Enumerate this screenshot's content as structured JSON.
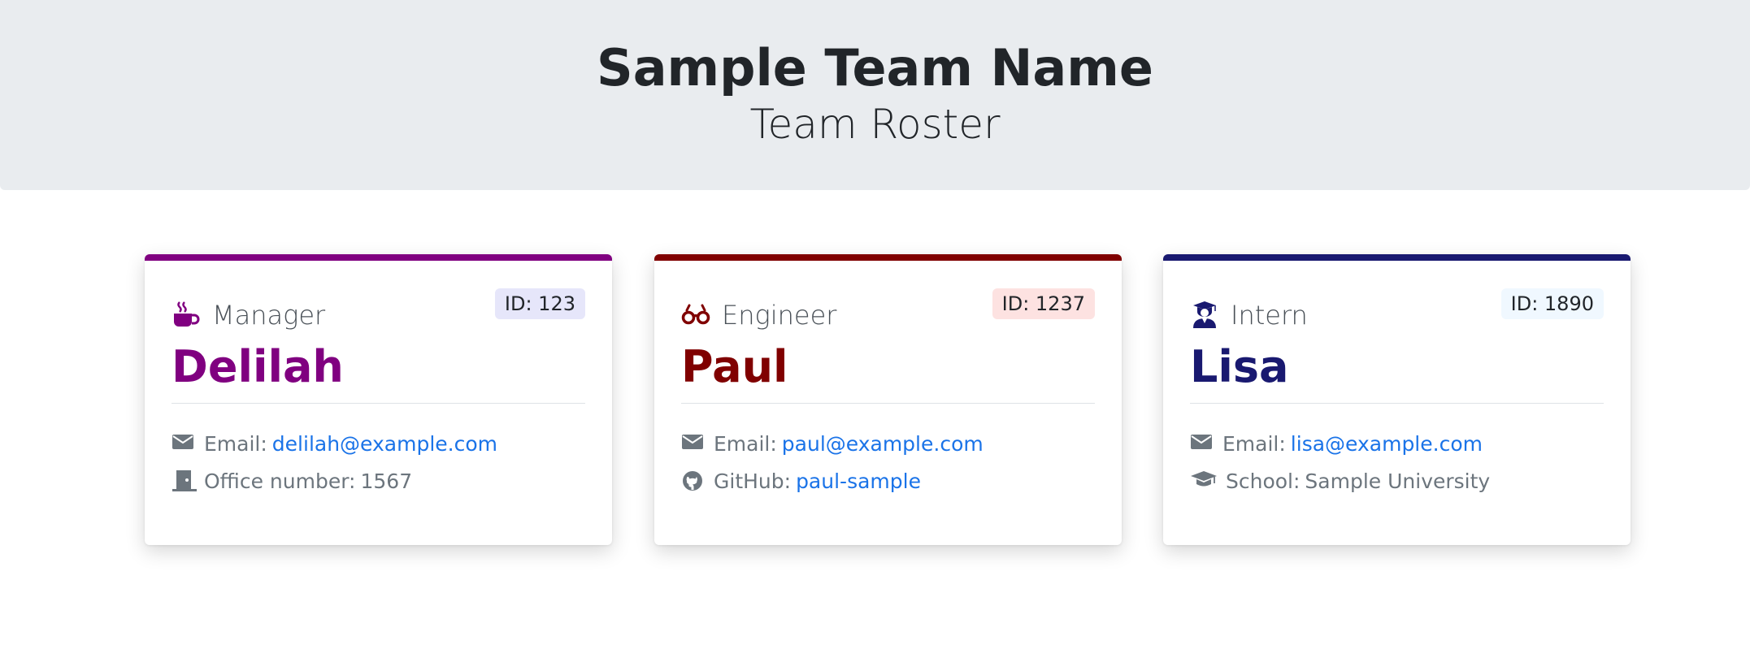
{
  "header": {
    "team_name": "Sample Team Name",
    "subtitle": "Team Roster"
  },
  "cards": [
    {
      "role": "Manager",
      "role_icon": "coffee-mug-icon",
      "id_label": "ID: 123",
      "name": "Delilah",
      "accent_color": "#800080",
      "badge_color": "#e6e6fa",
      "details": [
        {
          "icon": "envelope-icon",
          "label": "Email:",
          "value": "delilah@example.com",
          "is_link": true
        },
        {
          "icon": "door-icon",
          "label": "Office number:",
          "value": "1567",
          "is_link": false
        }
      ]
    },
    {
      "role": "Engineer",
      "role_icon": "glasses-icon",
      "id_label": "ID: 1237",
      "name": "Paul",
      "accent_color": "#800000",
      "badge_color": "#fde2e1",
      "details": [
        {
          "icon": "envelope-icon",
          "label": "Email:",
          "value": "paul@example.com",
          "is_link": true
        },
        {
          "icon": "github-icon",
          "label": "GitHub:",
          "value": "paul-sample",
          "is_link": true
        }
      ]
    },
    {
      "role": "Intern",
      "role_icon": "graduate-user-icon",
      "id_label": "ID: 1890",
      "name": "Lisa",
      "accent_color": "#191970",
      "badge_color": "#f0f8ff",
      "details": [
        {
          "icon": "envelope-icon",
          "label": "Email:",
          "value": "lisa@example.com",
          "is_link": true
        },
        {
          "icon": "graduation-cap-icon",
          "label": "School:",
          "value": "Sample University",
          "is_link": false
        }
      ]
    }
  ],
  "colors": {
    "jumbotron_bg": "#e9ecef",
    "link": "#1a73e8",
    "muted_text": "#6c757d"
  }
}
